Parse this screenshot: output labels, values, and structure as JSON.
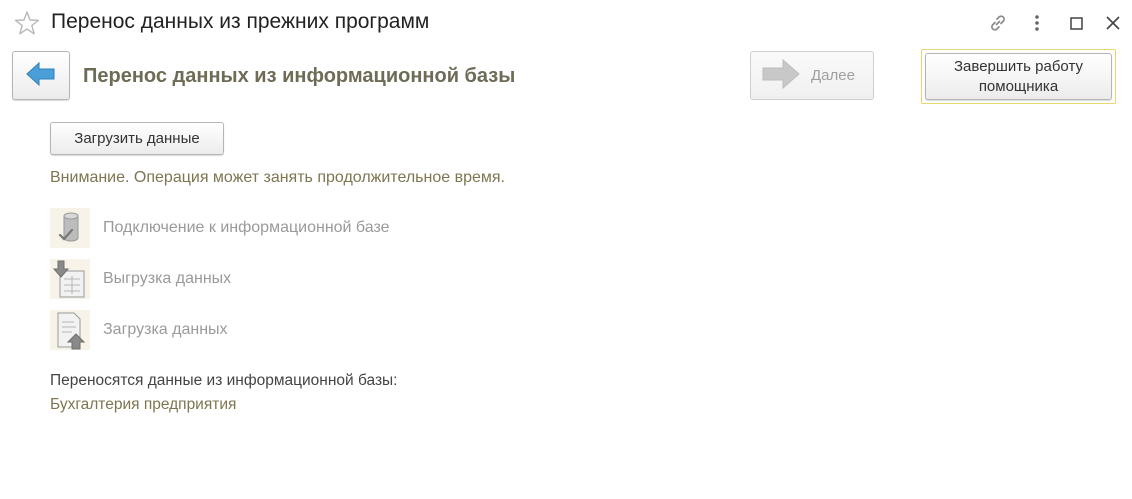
{
  "window": {
    "title": "Перенос данных из прежних программ",
    "icons": [
      "star-icon",
      "link-icon",
      "more-icon",
      "maximize-icon",
      "close-icon"
    ]
  },
  "toolbar": {
    "back_icon": "back-arrow-icon",
    "section_title": "Перенос данных из информационной базы",
    "next_label": "Далее",
    "finish_label_line1": "Завершить работу",
    "finish_label_line2": "помощника"
  },
  "main": {
    "load_button": "Загрузить данные",
    "warning": "Внимание. Операция может занять продолжительное время.",
    "steps": [
      {
        "label": "Подключение к информационной базе",
        "icon": "database-check-icon"
      },
      {
        "label": "Выгрузка данных",
        "icon": "export-data-icon"
      },
      {
        "label": "Загрузка данных",
        "icon": "import-data-icon"
      }
    ],
    "source_label": "Переносятся данные из информационной базы:",
    "source_link": "Бухгалтерия предприятия"
  },
  "colors": {
    "accent_title": "#6e6b56",
    "link": "#7d7651",
    "arrow_blue": "#4a9fd8",
    "disabled": "#a0a0a0"
  }
}
